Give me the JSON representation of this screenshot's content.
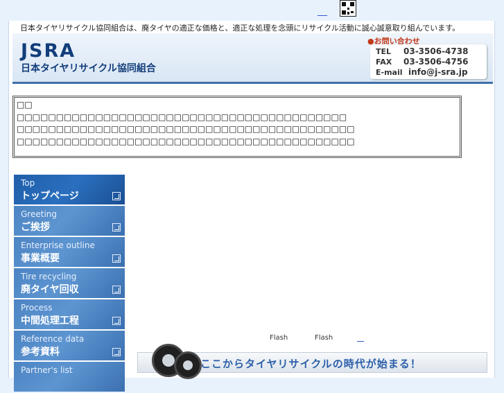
{
  "tagline": "日本タイヤリサイクル協同組合は、廃タイヤの適正な価格と、適正な処理を念頭にリサイクル活動に誠心誠意取り組んでいます。",
  "header": {
    "logo": "JSRA",
    "org_name": "日本タイヤリサイクル協同組合",
    "contact_title": "●お問い合わせ",
    "tel_label": "TEL",
    "tel": "03-3506-4738",
    "fax_label": "FAX",
    "fax": "03-3506-4756",
    "email_label": "E-mail",
    "email": "info@j-sra.jp"
  },
  "notice": {
    "line1": "□□",
    "line2": "□□□□□□□□□□□□□□□□□□□□□□□□□□□□□□□□□□□□□□□□□□",
    "line3": "□□□□□□□□□□□□□□□□□□□□□□□□□□□□□□□□□□□□□□□□□□□",
    "line4": "□□□□□□□□□□□□□□□□□□□□□□□□□□□□□□□□□□□□□□□□□□□"
  },
  "nav": [
    {
      "en": "Top",
      "ja": "トップページ"
    },
    {
      "en": "Greeting",
      "ja": "ご挨拶"
    },
    {
      "en": "Enterprise outline",
      "ja": "事業概要"
    },
    {
      "en": "Tire recycling",
      "ja": "廃タイヤ回収"
    },
    {
      "en": "Process",
      "ja": "中間処理工程"
    },
    {
      "en": "Reference data",
      "ja": "参考資料"
    },
    {
      "en": "Partner's list",
      "ja": ""
    }
  ],
  "flash": {
    "note1": "Flash",
    "note2": "Flash"
  },
  "banner": {
    "text": "ここからタイヤリサイクルの時代が始まる！"
  },
  "colors": {
    "nav_blue": "#4d84c3",
    "nav_active": "#1f5ea8",
    "logo": "#123e7a",
    "accent_red": "#c23a1a",
    "banner_text": "#2b5fa8"
  }
}
